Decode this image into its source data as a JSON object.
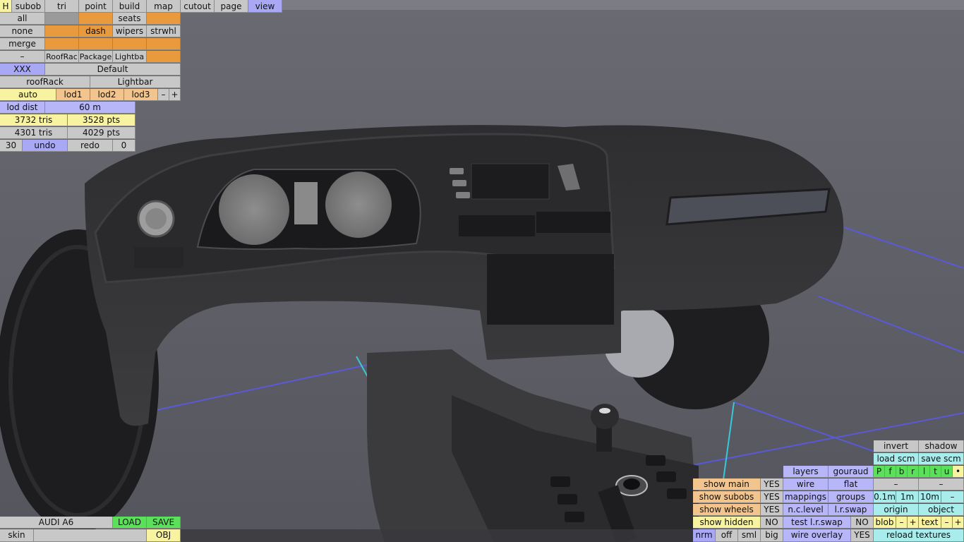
{
  "top_bar": {
    "h": "H",
    "subob": "subob",
    "tri": "tri",
    "point": "point",
    "build": "build",
    "map": "map",
    "cutout": "cutout",
    "page": "page",
    "view": "view"
  },
  "subobs": {
    "all": "all",
    "seats": "seats",
    "none": "none",
    "dash": "dash",
    "wipers": "wipers",
    "strwhl": "strwhl",
    "merge": "merge",
    "dash_btn": "–",
    "roofrack": "RoofRac",
    "package": "Package",
    "lightbar": "Lightba"
  },
  "variant": {
    "xxx": "XXX",
    "default": "Default",
    "roofrack": "roofRack",
    "lightbar": "Lightbar"
  },
  "lod": {
    "auto": "auto",
    "lod1": "lod1",
    "lod2": "lod2",
    "lod3": "lod3",
    "minus": "–",
    "plus": "+"
  },
  "stats": {
    "lod_dist_label": "lod dist",
    "lod_dist": "60 m",
    "tris1": "3732 tris",
    "pts1": "3528 pts",
    "tris2": "4301 tris",
    "pts2": "4029 pts",
    "count": "30",
    "undo": "undo",
    "redo": "redo",
    "redo_count": "0"
  },
  "file": {
    "name": "AUDI A6",
    "load": "LOAD",
    "save": "SAVE",
    "skin": "skin",
    "obj": "OBJ"
  },
  "view_panel": {
    "invert": "invert",
    "shadow": "shadow",
    "load_scm": "load scm",
    "save_scm": "save scm",
    "flags": [
      "P",
      "f",
      "b",
      "r",
      "l",
      "t",
      "u",
      "•"
    ],
    "layers": "layers",
    "gouraud": "gouraud",
    "wire": "wire",
    "flat": "flat",
    "mappings": "mappings",
    "groups": "groups",
    "nc_level": "n.c.level",
    "lr_swap": "l.r.swap",
    "test_lr_swap": "test l.r.swap",
    "test_lr_swap_val": "NO",
    "wire_overlay": "wire overlay",
    "wire_overlay_val": "YES",
    "dash1": "–",
    "dash2": "–",
    "dist1": "0.1m",
    "dist2": "1m",
    "dist3": "10m",
    "dist_minus": "–",
    "origin": "origin",
    "object": "object",
    "blob": "blob",
    "minus": "–",
    "plus": "+",
    "text": "text",
    "reload": "reload textures"
  },
  "show": {
    "main": "show main",
    "main_val": "YES",
    "subobs": "show subobs",
    "subobs_val": "YES",
    "wheels": "show wheels",
    "wheels_val": "YES",
    "hidden": "show hidden",
    "hidden_val": "NO",
    "nrm": "nrm",
    "off": "off",
    "sml": "sml",
    "big": "big"
  }
}
